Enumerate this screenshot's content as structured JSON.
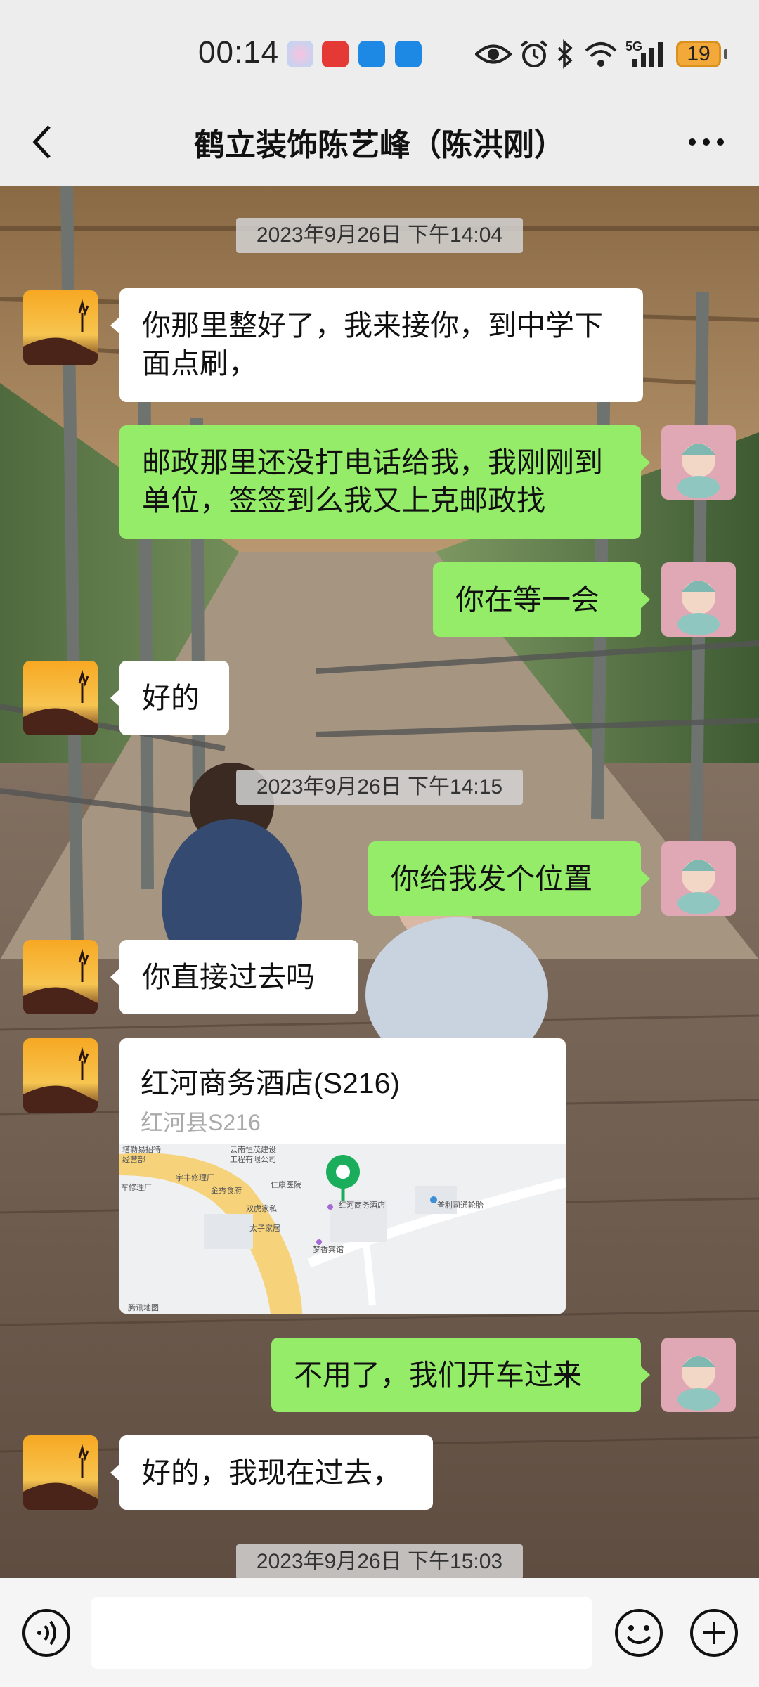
{
  "status_bar": {
    "time": "00:14",
    "battery": "19",
    "network": "5G"
  },
  "nav": {
    "title": "鹤立装饰陈艺峰（陈洪刚）"
  },
  "messages": [
    {
      "type": "timestamp",
      "text": "2023年9月26日 下午14:04"
    },
    {
      "type": "incoming",
      "text": "你那里整好了，我来接你，到中学下面点刷，"
    },
    {
      "type": "outgoing",
      "text": "邮政那里还没打电话给我，我刚刚到单位，签签到么我又上克邮政找"
    },
    {
      "type": "outgoing",
      "text": "你在等一会"
    },
    {
      "type": "incoming",
      "text": "好的"
    },
    {
      "type": "timestamp",
      "text": "2023年9月26日 下午14:15"
    },
    {
      "type": "outgoing",
      "text": "你给我发个位置"
    },
    {
      "type": "incoming",
      "text": "你直接过去吗"
    },
    {
      "type": "location",
      "name": "红河商务酒店(S216)",
      "address": "红河县S216",
      "map_labels": [
        "塔勒易招待",
        "经营部",
        "云南恒茂建设",
        "工程有限公司",
        "宇丰修理厂",
        "车修理厂",
        "金秀食府",
        "仁康医院",
        "双虎家私",
        "太子家居",
        "红河商务酒店",
        "普利司通轮胎",
        "梦香宾馆",
        "腾讯地图"
      ]
    },
    {
      "type": "outgoing",
      "text": "不用了，我们开车过来"
    },
    {
      "type": "incoming",
      "text": "好的，我现在过去，"
    },
    {
      "type": "timestamp",
      "text": "2023年9月26日 下午15:03"
    }
  ],
  "input": {
    "placeholder": ""
  },
  "colors": {
    "outgoing_bubble": "#95ec69",
    "incoming_bubble": "#ffffff",
    "map_pin": "#1aad5c"
  }
}
